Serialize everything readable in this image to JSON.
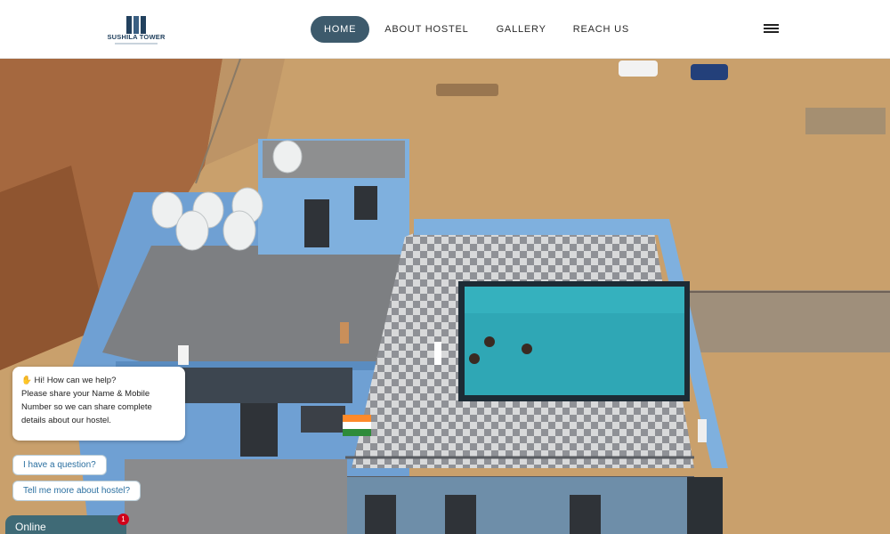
{
  "header": {
    "logo_text": "SUSHILA TOWER",
    "nav": [
      {
        "label": "HOME",
        "active": true
      },
      {
        "label": "ABOUT HOSTEL",
        "active": false
      },
      {
        "label": "GALLERY",
        "active": false
      },
      {
        "label": "REACH US",
        "active": false
      }
    ],
    "menu_icon": "hamburger-icon"
  },
  "hero": {
    "image_description_icon": "aerial-rooftop-pool-photo"
  },
  "chat": {
    "greeting_line1": "Hi! How can we help?",
    "greeting_line2": "Please share your Name & Mobile",
    "greeting_line3": "Number so we can share complete",
    "greeting_line4": "details about our hostel.",
    "quick_replies": [
      {
        "label": "I have a question?"
      },
      {
        "label": "Tell me more about hostel?"
      }
    ],
    "status_label": "Online",
    "unread_count": "1"
  },
  "colors": {
    "nav_active_bg": "#3d5a6c",
    "online_tab_bg": "#3f6a76",
    "badge_bg": "#d0021b",
    "pool_water": "#2fa7b5"
  }
}
